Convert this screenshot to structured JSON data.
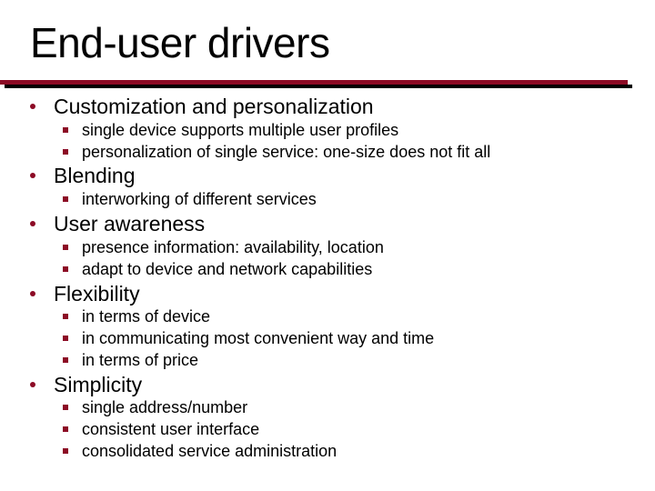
{
  "slide": {
    "title": "End-user drivers",
    "accent_color": "#8c0b25",
    "sections": [
      {
        "heading": "Customization and personalization",
        "items": [
          "single device supports multiple user profiles",
          "personalization of single service: one-size does not fit all"
        ]
      },
      {
        "heading": "Blending",
        "items": [
          "interworking of different services"
        ]
      },
      {
        "heading": "User awareness",
        "items": [
          "presence information: availability, location",
          "adapt to device and network capabilities"
        ]
      },
      {
        "heading": "Flexibility",
        "items": [
          "in terms of device",
          "in communicating most convenient way and time",
          "in terms of price"
        ]
      },
      {
        "heading": "Simplicity",
        "items": [
          "single address/number",
          "consistent user interface",
          "consolidated service administration"
        ]
      }
    ]
  }
}
